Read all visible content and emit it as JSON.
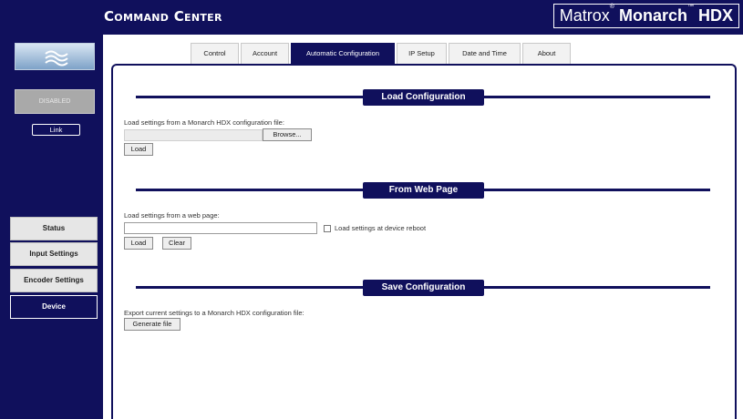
{
  "header": {
    "brand": "Command Center",
    "product_light": "Matrox",
    "product_reg": "®",
    "product_bold": "Monarch",
    "product_tm": "™",
    "product_bold2": "HDX"
  },
  "sidebar": {
    "status_button": "DISABLED",
    "link_button": "Link",
    "nav": [
      {
        "label": "Status",
        "active": false
      },
      {
        "label": "Input Settings",
        "active": false
      },
      {
        "label": "Encoder Settings",
        "active": false
      },
      {
        "label": "Device",
        "active": true
      }
    ]
  },
  "tabs": [
    {
      "label": "Control",
      "active": false
    },
    {
      "label": "Account",
      "active": false
    },
    {
      "label": "Automatic Configuration",
      "active": true
    },
    {
      "label": "IP Setup",
      "active": false
    },
    {
      "label": "Date and Time",
      "active": false
    },
    {
      "label": "About",
      "active": false
    }
  ],
  "load_config": {
    "title": "Load Configuration",
    "description": "Load settings from a Monarch HDX configuration file:",
    "file_value": "",
    "browse_label": "Browse...",
    "load_label": "Load"
  },
  "web_page": {
    "title": "From Web Page",
    "description": "Load settings from a web page:",
    "url_value": "",
    "checkbox_label": "Load settings at device reboot",
    "checkbox_checked": false,
    "load_label": "Load",
    "clear_label": "Clear"
  },
  "save_config": {
    "title": "Save Configuration",
    "description": "Export current settings to a Monarch HDX configuration file:",
    "generate_label": "Generate file"
  },
  "colors": {
    "navy": "#10105c",
    "panel_gray": "#e6e6e6",
    "disabled_gray": "#a9a9a9"
  }
}
